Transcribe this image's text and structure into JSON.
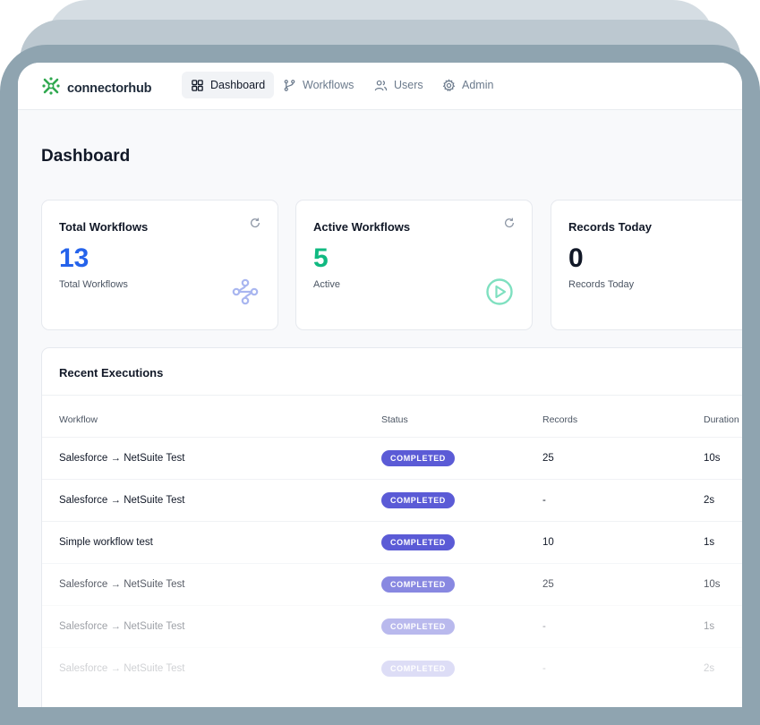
{
  "app": {
    "brand": "connectorhub",
    "colors": {
      "accent": "#2563eb",
      "active": "#10b981",
      "badge": "#5b5bd6",
      "logo": "#2fa84f"
    }
  },
  "nav": {
    "items": [
      {
        "label": "Dashboard",
        "icon": "grid-icon",
        "active": true
      },
      {
        "label": "Workflows",
        "icon": "branch-icon",
        "active": false
      },
      {
        "label": "Users",
        "icon": "users-icon",
        "active": false
      },
      {
        "label": "Admin",
        "icon": "gear-icon",
        "active": false
      }
    ]
  },
  "page": {
    "title": "Dashboard"
  },
  "stats": [
    {
      "title": "Total Workflows",
      "value": "13",
      "subtitle": "Total Workflows",
      "value_color": "#2563eb",
      "icon": "workflow-icon"
    },
    {
      "title": "Active Workflows",
      "value": "5",
      "subtitle": "Active",
      "value_color": "#10b981",
      "icon": "play-circle-icon"
    },
    {
      "title": "Records Today",
      "value": "0",
      "subtitle": "Records Today",
      "value_color": "#111827",
      "icon": ""
    }
  ],
  "executions": {
    "title": "Recent Executions",
    "columns": [
      "Workflow",
      "Status",
      "Records",
      "Duration"
    ],
    "rows": [
      {
        "workflow": "Salesforce → NetSuite Test",
        "status": "COMPLETED",
        "records": "25",
        "duration": "10s"
      },
      {
        "workflow": "Salesforce → NetSuite Test",
        "status": "COMPLETED",
        "records": "-",
        "duration": "2s"
      },
      {
        "workflow": "Simple workflow test",
        "status": "COMPLETED",
        "records": "10",
        "duration": "1s"
      },
      {
        "workflow": "Salesforce → NetSuite Test",
        "status": "COMPLETED",
        "records": "25",
        "duration": "10s"
      },
      {
        "workflow": "Salesforce → NetSuite Test",
        "status": "COMPLETED",
        "records": "-",
        "duration": "1s"
      },
      {
        "workflow": "Salesforce → NetSuite Test",
        "status": "COMPLETED",
        "records": "-",
        "duration": "2s"
      }
    ]
  }
}
